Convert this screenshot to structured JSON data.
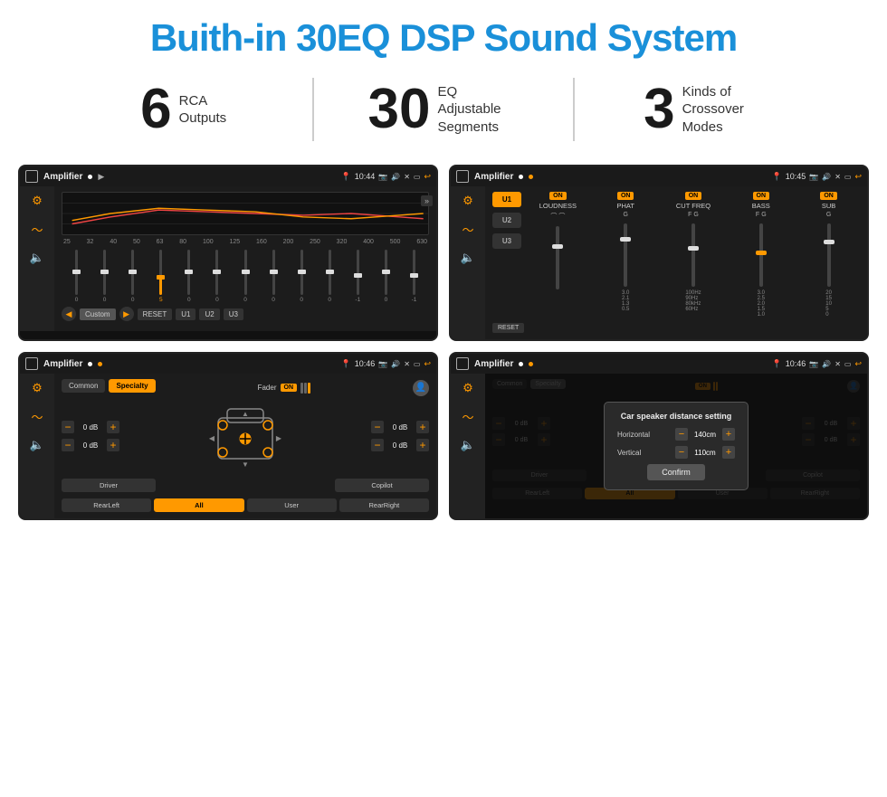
{
  "page": {
    "title": "Buith-in 30EQ DSP Sound System"
  },
  "stats": [
    {
      "number": "6",
      "label": "RCA\nOutputs"
    },
    {
      "number": "30",
      "label": "EQ Adjustable\nSegments"
    },
    {
      "number": "3",
      "label": "Kinds of\nCrossover Modes"
    }
  ],
  "screens": [
    {
      "id": "eq-screen",
      "status": {
        "title": "Amplifier",
        "time": "10:44"
      },
      "type": "eq"
    },
    {
      "id": "crossover-screen",
      "status": {
        "title": "Amplifier",
        "time": "10:45"
      },
      "type": "crossover"
    },
    {
      "id": "fader-screen",
      "status": {
        "title": "Amplifier",
        "time": "10:46"
      },
      "type": "fader"
    },
    {
      "id": "distance-screen",
      "status": {
        "title": "Amplifier",
        "time": "10:46"
      },
      "type": "distance"
    }
  ],
  "eq": {
    "frequencies": [
      "25",
      "32",
      "40",
      "50",
      "63",
      "80",
      "100",
      "125",
      "160",
      "200",
      "250",
      "320",
      "400",
      "500",
      "630"
    ],
    "values": [
      "0",
      "0",
      "0",
      "5",
      "0",
      "0",
      "0",
      "0",
      "0",
      "0",
      "-1",
      "0",
      "-1"
    ],
    "presets": [
      "Custom",
      "RESET",
      "U1",
      "U2",
      "U3"
    ],
    "slider_positions": [
      50,
      50,
      50,
      30,
      50,
      50,
      50,
      50,
      50,
      50,
      60,
      50,
      60
    ]
  },
  "crossover": {
    "presets": [
      "U1",
      "U2",
      "U3"
    ],
    "active_preset": "U1",
    "controls": [
      {
        "label": "LOUDNESS",
        "on": true
      },
      {
        "label": "PHAT",
        "on": true
      },
      {
        "label": "CUT FREQ",
        "on": true
      },
      {
        "label": "BASS",
        "on": true
      },
      {
        "label": "SUB",
        "on": true
      }
    ]
  },
  "fader": {
    "tabs": [
      "Common",
      "Specialty"
    ],
    "active_tab": "Specialty",
    "fader_label": "Fader",
    "fader_on": true,
    "volumes": [
      "0 dB",
      "0 dB",
      "0 dB",
      "0 dB"
    ],
    "buttons": [
      "Driver",
      "",
      "",
      "Copilot",
      "RearLeft",
      "All",
      "",
      "User",
      "RearRight"
    ]
  },
  "distance_dialog": {
    "title": "Car speaker distance setting",
    "horizontal_label": "Horizontal",
    "horizontal_value": "140cm",
    "vertical_label": "Vertical",
    "vertical_value": "110cm",
    "confirm_label": "Confirm"
  }
}
